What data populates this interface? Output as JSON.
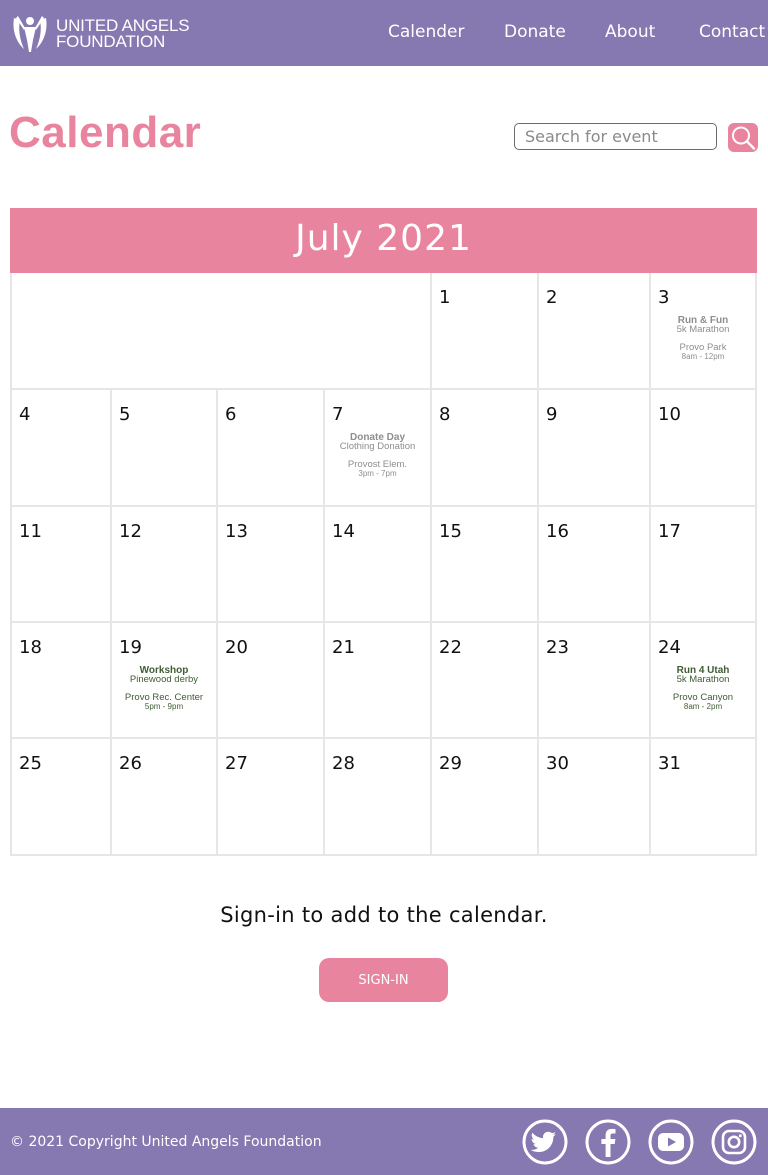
{
  "header": {
    "logo_line1": "UNITED ANGELS",
    "logo_line2": "FOUNDATION",
    "nav": [
      "Calender",
      "Donate",
      "About",
      "Contact"
    ]
  },
  "page": {
    "title": "Calendar",
    "search_placeholder": "Search for event"
  },
  "calendar": {
    "month_label": "July 2021",
    "days": [
      "1",
      "2",
      "3",
      "4",
      "5",
      "6",
      "7",
      "8",
      "9",
      "10",
      "11",
      "12",
      "13",
      "14",
      "15",
      "16",
      "17",
      "18",
      "19",
      "20",
      "21",
      "22",
      "23",
      "24",
      "25",
      "26",
      "27",
      "28",
      "29",
      "30",
      "31"
    ],
    "events": [
      {
        "day": "3",
        "title": "Run & Fun",
        "subtitle": "5k Marathon",
        "location": "Provo Park",
        "time": "8am - 12pm",
        "style": "gray"
      },
      {
        "day": "7",
        "title": "Donate Day",
        "subtitle": "Clothing Donation",
        "location": "Provost Elem.",
        "time": "3pm - 7pm",
        "style": "gray"
      },
      {
        "day": "19",
        "title": "Workshop",
        "subtitle": "Pinewood derby",
        "location": "Provo Rec. Center",
        "time": "5pm - 9pm",
        "style": "green"
      },
      {
        "day": "24",
        "title": "Run 4 Utah",
        "subtitle": "5k Marathon",
        "location": "Provo Canyon",
        "time": "8am - 2pm",
        "style": "green"
      }
    ]
  },
  "signin": {
    "prompt": "Sign-in to add to the calendar.",
    "button_label": "SIGN-IN"
  },
  "footer": {
    "copyright": "© 2021 Copyright United Angels Foundation",
    "social": [
      "twitter-icon",
      "facebook-icon",
      "youtube-icon",
      "instagram-icon"
    ]
  },
  "colors": {
    "brand_purple": "#8678b0",
    "accent_pink": "#e8849e",
    "event_gray": "#8e8e8e",
    "event_green": "#3f5c33"
  }
}
